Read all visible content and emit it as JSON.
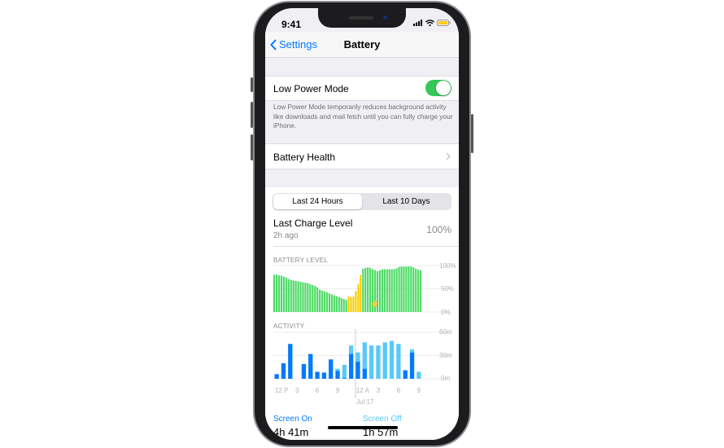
{
  "status": {
    "time": "9:41"
  },
  "nav": {
    "back_label": "Settings",
    "title": "Battery"
  },
  "low_power": {
    "label": "Low Power Mode",
    "enabled": true,
    "footer": "Low Power Mode temporarily reduces background activity like downloads and mail fetch until you can fully charge your iPhone."
  },
  "battery_health": {
    "label": "Battery Health"
  },
  "segments": {
    "options": [
      "Last 24 Hours",
      "Last 10 Days"
    ],
    "selected": "Last 24 Hours"
  },
  "last_charge": {
    "label": "Last Charge Level",
    "sub": "2h ago",
    "value": "100%"
  },
  "colors": {
    "accent": "#007aff",
    "green": "#4cd964",
    "yellow": "#ffcc00",
    "screen_on": "#007aff",
    "screen_off": "#5ac8fa"
  },
  "chart_data": [
    {
      "type": "bar",
      "title": "BATTERY LEVEL",
      "y_ticks": [
        "100%",
        "50%",
        "0%"
      ],
      "ylim": [
        0,
        100
      ],
      "values": [
        80,
        80,
        79,
        78,
        76,
        74,
        71,
        69,
        68,
        67,
        66,
        65,
        64,
        63,
        62,
        60,
        58,
        56,
        53,
        48,
        46,
        44,
        42,
        40,
        38,
        36,
        34,
        32,
        30,
        28,
        26,
        33,
        33,
        33,
        45,
        60,
        80,
        93,
        95,
        96,
        95,
        92,
        90,
        88,
        90,
        92,
        92,
        92,
        92,
        92,
        92,
        94,
        97,
        98,
        98,
        98,
        98,
        98,
        96,
        93,
        91,
        90
      ],
      "low_power_range": [
        31,
        36
      ]
    },
    {
      "type": "bar",
      "title": "ACTIVITY",
      "y_ticks": [
        "60m",
        "30m",
        "0m"
      ],
      "ylim": [
        0,
        60
      ],
      "x_labels": [
        "12 P",
        "3",
        "6",
        "9",
        "12 A",
        "3",
        "6",
        "9"
      ],
      "date_label": "Jul 17",
      "series": [
        {
          "name": "Screen On",
          "values": [
            6,
            20,
            45,
            0,
            19,
            32,
            9,
            8,
            25,
            10,
            1,
            32,
            22,
            13,
            0,
            0,
            0,
            0,
            0,
            11,
            34,
            0
          ]
        },
        {
          "name": "Screen Off",
          "values": [
            0,
            0,
            0,
            0,
            0,
            0,
            0,
            0,
            0,
            3,
            17,
            11,
            12,
            34,
            43,
            43,
            47,
            49,
            45,
            0,
            4,
            9
          ]
        }
      ]
    }
  ],
  "totals": {
    "screen_on_label": "Screen On",
    "screen_on_value": "4h 41m",
    "screen_off_label": "Screen Off",
    "screen_off_value": "1h 57m"
  }
}
